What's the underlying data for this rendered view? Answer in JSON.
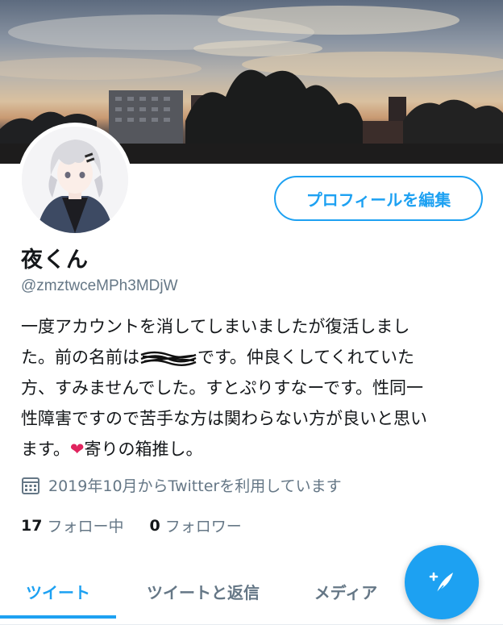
{
  "profile": {
    "display_name": "夜くん",
    "handle": "@zmztwceMPh3MDjW",
    "edit_button": "プロフィールを編集",
    "bio": {
      "line1": "一度アカウントを消してしまいましたが復活しまし",
      "line2_before": "た。前の名前は",
      "line2_after": "です。仲良くしてくれていた",
      "line3": "方、すみませんでした。すとぷりすなーです。性同一",
      "line4": "性障害ですので苦手な方は関わらない方が良いと思い",
      "line5_before": "ます。",
      "heart": "❤",
      "line5_after": "寄りの箱推し。"
    },
    "joined": "2019年10月からTwitterを利用しています",
    "following_count": "17",
    "following_label": "フォロー中",
    "followers_count": "0",
    "followers_label": "フォロワー"
  },
  "tabs": [
    {
      "label": "ツイート",
      "active": true
    },
    {
      "label": "ツイートと返信",
      "active": false
    },
    {
      "label": "メディア",
      "active": false
    }
  ],
  "icons": {
    "calendar": "calendar-icon",
    "compose": "compose-tweet-icon"
  },
  "colors": {
    "accent": "#1da1f2",
    "secondary_text": "#657786",
    "heart": "#e0245e"
  }
}
